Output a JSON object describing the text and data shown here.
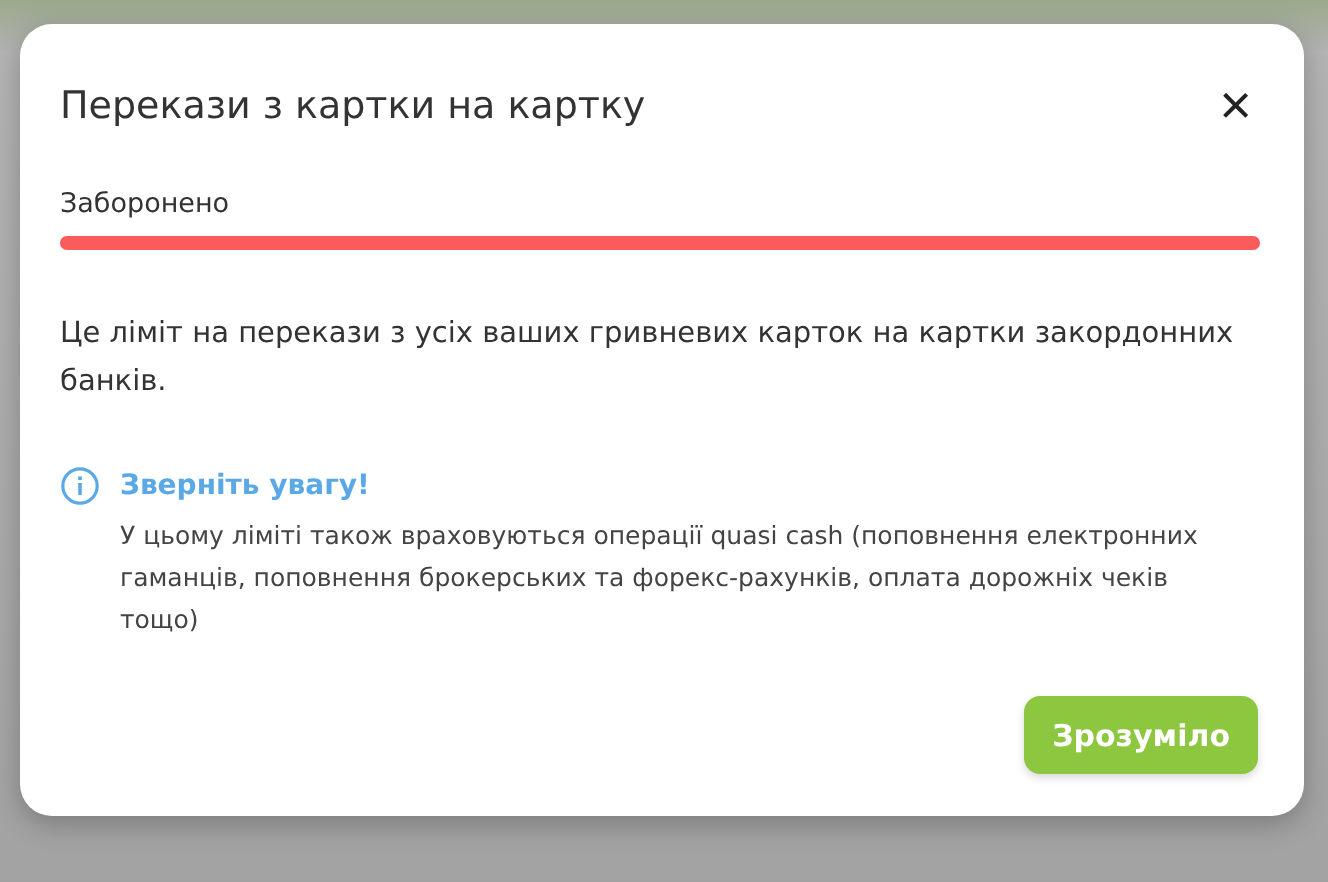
{
  "dialog": {
    "title": "Перекази з картки на картку",
    "close": "×"
  },
  "limit": {
    "label": "Заборонено",
    "level": 1
  },
  "description": "Це ліміт на перекази з усіх ваших гривневих карток на картки закордонних банків.",
  "notice": {
    "title": "Зверніть увагу!",
    "text": "У цьому ліміті також враховуються операції quasi cash (поповнення електронних гаманців, поповнення брокерських та форекс-рахунків, оплата дорожніх чеків тощо)"
  },
  "buttons": [
    "Зрозуміло"
  ]
}
